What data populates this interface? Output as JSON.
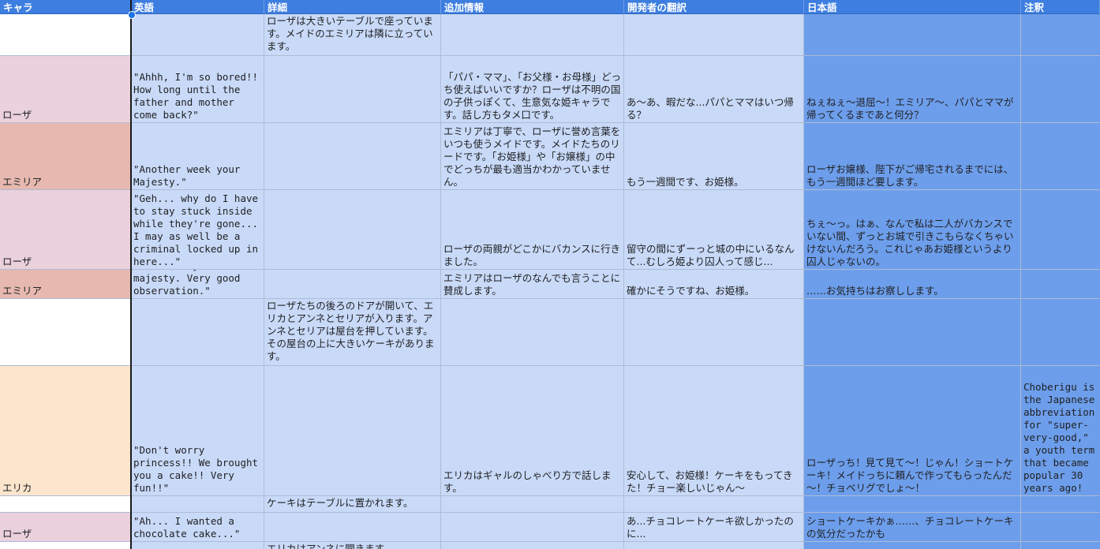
{
  "headers": [
    "キャラ",
    "英語",
    "詳細",
    "追加情報",
    "開発者の翻訳",
    "日本語",
    "注釈"
  ],
  "colors": {
    "header_bg": "#3d7ee0",
    "light_blue": "#c9daf8",
    "mid_blue": "#6d9eeb",
    "rosa": "#ead1dc",
    "emilia": "#e6b8af",
    "erika": "#fce5cd",
    "white": "#ffffff"
  },
  "rows": [
    {
      "char": "",
      "english": "",
      "detail": "ローザは大きいテーブルで座っています。メイドのエミリアは隣に立っています。",
      "extra": "",
      "dev": "",
      "japanese": "",
      "note": ""
    },
    {
      "char": "ローザ",
      "english": "\"Ahhh, I'm so bored!! How long until the father and mother come back?\"",
      "detail": "",
      "extra": "「パパ・ママ」、「お父様・お母様」どっち使えばいいですか？ローザは不明の国の子供っぽくて、生意気な姫キャラです。話し方もタメ口です。",
      "dev": "あ～あ、暇だな...パパとママはいつ帰る？",
      "japanese": "ねぇねぇ～退屈～！エミリア～、パパとママが帰ってくるまであと何分？",
      "note": ""
    },
    {
      "char": "エミリア",
      "english": "\"Another week your Majesty.\"",
      "detail": "",
      "extra": "エミリアは丁寧で、ローザに誉め言葉をいつも使うメイドです。メイドたちのリードです。「お姫様」や「お嬢様」の中でどっちが最も適当かわかっていません。",
      "dev": "もう一週間です、お姫様。",
      "japanese": "ローザお嬢様、陛下がご帰宅されるまでには、もう一週間ほど要します。",
      "note": ""
    },
    {
      "char": "ローザ",
      "english": "\"Geh... why do I have to stay stuck inside while they're gone... I may as well be a criminal locked up in here...\"",
      "detail": "",
      "extra": "ローザの両親がどこかにバカンスに行きました。",
      "dev": "留守の間にずーっと城の中にいるなんて...むしろ姫より囚人って感じ...",
      "japanese": "ちぇ～っ。はぁ、なんで私は二人がバカンスでいない間、ずっとお城で引きこもらなくちゃいけないんだろう。これじゃあお姫様というより囚人じゃないの。",
      "note": ""
    },
    {
      "char": "エミリア",
      "english": " \"So true your majesty. Very good observation.\"",
      "detail": "",
      "extra": "エミリアはローザのなんでも言うことに賛成します。",
      "dev": "確かにそうですね、お姫様。",
      "japanese": "……お気持ちはお察しします。",
      "note": ""
    },
    {
      "char": "",
      "english": "",
      "detail": "ローザたちの後ろのドアが開いて、エリカとアンネとセリアが入ります。アンネとセリアは屋台を押しています。その屋台の上に大きいケーキがあります。",
      "extra": "",
      "dev": "",
      "japanese": "",
      "note": ""
    },
    {
      "char": "エリカ",
      "english": "\"Don't worry princess!! We brought you a cake!! Very fun!!\"",
      "detail": "",
      "extra": "エリカはギャルのしゃべり方で話します。",
      "dev": "安心して、お姫様！ケーキをもってきた！チョー楽しいじゃん～",
      "japanese": "ローザっち！見て見て～！じゃん！ショートケーキ！メイドっちに頼んで作ってもらったんだ～！チョベリグでしょ～！",
      "note": "Choberigu is the Japanese abbreviation for \"super-very-good,\" a youth term that became popular 30 years ago!"
    },
    {
      "char": "",
      "english": "",
      "detail": "ケーキはテーブルに置かれます。",
      "extra": "",
      "dev": "",
      "japanese": "",
      "note": ""
    },
    {
      "char": "ローザ",
      "english": "\"Ah... I wanted a chocolate cake...\"",
      "detail": "",
      "extra": "",
      "dev": "あ...チョコレートケーキ欲しかったのに...",
      "japanese": "ショートケーキかぁ……、チョコレートケーキの気分だったかも",
      "note": ""
    },
    {
      "char": "",
      "english": "",
      "detail": "エリカはアンネに聞きます",
      "extra": "",
      "dev": "",
      "japanese": "",
      "note": ""
    }
  ]
}
